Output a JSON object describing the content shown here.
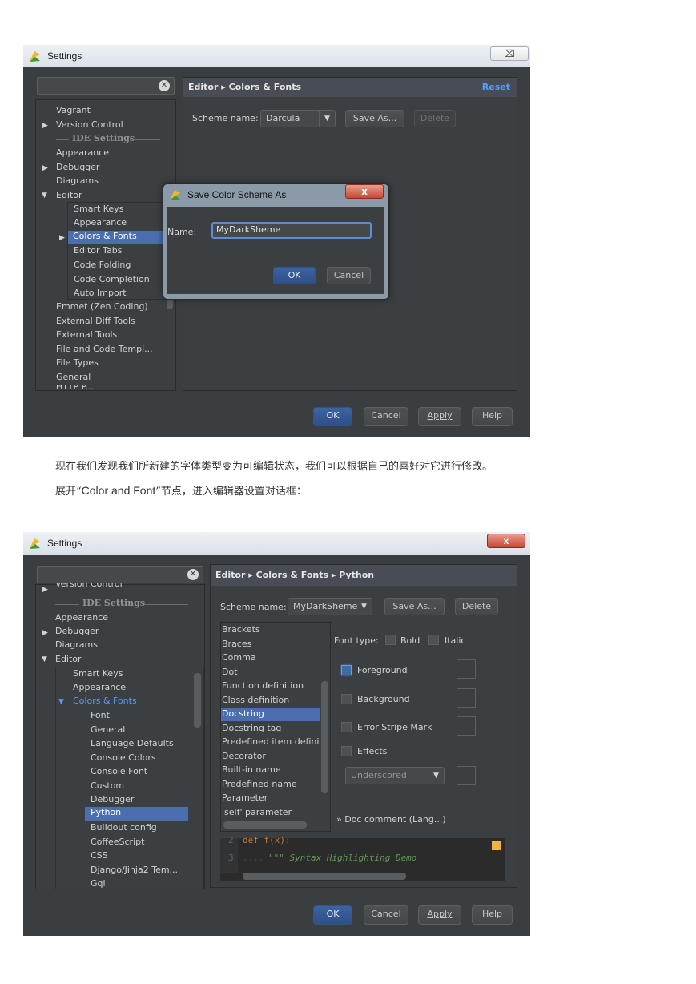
{
  "colors": {
    "accent": "#4b6eaf",
    "panel_bg": "#3c3f41",
    "header_bg": "#474c55",
    "link": "#589df6"
  },
  "window1": {
    "title": "Settings",
    "close_glyph": "⌧",
    "header": "Editor ▸ Colors & Fonts",
    "reset": "Reset",
    "scheme_label": "Scheme name:",
    "scheme_value": "Darcula",
    "save_as": "Save As...",
    "delete": "Delete",
    "tree": {
      "vagrant": "Vagrant",
      "version_control": "Version Control",
      "ide_settings": "IDE Settings",
      "appearance": "Appearance",
      "debugger": "Debugger",
      "diagrams": "Diagrams",
      "editor": "Editor",
      "smart_keys": "Smart Keys",
      "editor_appearance": "Appearance",
      "colors_fonts": "Colors & Fonts",
      "editor_tabs": "Editor Tabs",
      "code_folding": "Code Folding",
      "code_completion": "Code Completion",
      "auto_import": "Auto Import",
      "emmet": "Emmet (Zen Coding)",
      "external_diff": "External Diff Tools",
      "external_tools": "External Tools",
      "file_code_templ": "File and Code Templ...",
      "file_types": "File Types",
      "general": "General",
      "http_p": "HTTP P..."
    },
    "buttons": {
      "ok": "OK",
      "cancel": "Cancel",
      "apply": "Apply",
      "help": "Help"
    },
    "dialog": {
      "title": "Save Color Scheme As",
      "close_glyph": "x",
      "name_label": "Name:",
      "name_value": "MyDarkSheme",
      "ok": "OK",
      "cancel": "Cancel"
    }
  },
  "caption": {
    "line1": "现在我们发现我们所新建的字体类型变为可编辑状态，我们可以根据自己的喜好对它进行修改。",
    "line2_prefix": "展开“",
    "line2_latin": "Color and Font",
    "line2_suffix": "”节点，进入编辑器设置对话框："
  },
  "window2": {
    "title": "Settings",
    "close_glyph": "x",
    "header": "Editor ▸ Colors & Fonts ▸ Python",
    "scheme_label": "Scheme name:",
    "scheme_value": "MyDarkSheme",
    "save_as": "Save As...",
    "delete": "Delete",
    "tree": {
      "version_control": "Version Control",
      "ide_settings": "IDE Settings",
      "appearance": "Appearance",
      "debugger": "Debugger",
      "diagrams": "Diagrams",
      "editor": "Editor",
      "smart_keys": "Smart Keys",
      "editor_appearance": "Appearance",
      "colors_fonts": "Colors & Fonts",
      "font": "Font",
      "general": "General",
      "language_defaults": "Language Defaults",
      "console_colors": "Console Colors",
      "console_font": "Console Font",
      "custom": "Custom",
      "debugger_sub": "Debugger",
      "python": "Python",
      "buildout": "Buildout config",
      "coffeescript": "CoffeeScript",
      "css": "CSS",
      "django": "Django/Jinja2 Tem...",
      "gql": "Gql"
    },
    "elements": [
      "Brackets",
      "Braces",
      "Comma",
      "Dot",
      "Function definition",
      "Class definition",
      "Docstring",
      "Docstring tag",
      "Predefined item definiti",
      "Decorator",
      "Built-in name",
      "Predefined name",
      "Parameter",
      "'self' parameter"
    ],
    "font_type_label": "Font type:",
    "bold": "Bold",
    "italic": "Italic",
    "foreground": "Foreground",
    "background": "Background",
    "error_stripe": "Error Stripe Mark",
    "effects": "Effects",
    "effects_combo": "Underscored",
    "doc_comment": "» Doc comment (Lang...)",
    "code": {
      "line2_no": "2",
      "line2": "def f(x):",
      "line3_no": "3",
      "line3_dots": "....",
      "line3": "\"\"\" Syntax Highlighting Demo"
    },
    "buttons": {
      "ok": "OK",
      "cancel": "Cancel",
      "apply": "Apply",
      "help": "Help"
    }
  }
}
